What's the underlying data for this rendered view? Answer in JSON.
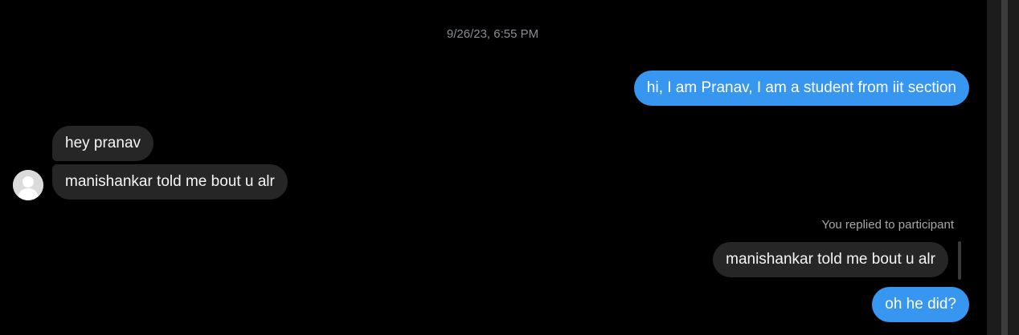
{
  "chat": {
    "timestamp": "9/26/23, 6:55 PM",
    "messages": {
      "out_1": "hi, I am Pranav, I am a student from iit section",
      "in_1": "hey pranav",
      "in_2": "manishankar told me bout u alr",
      "reply_label": "You replied to participant",
      "reply_quote": "manishankar told me bout u alr",
      "out_2": "oh he did?"
    }
  },
  "colors": {
    "background": "#000000",
    "outgoing_bubble": "#3797f0",
    "incoming_bubble": "#262626",
    "timestamp_text": "#8a8d91"
  },
  "icons": {
    "avatar": "default-user-avatar-icon"
  }
}
